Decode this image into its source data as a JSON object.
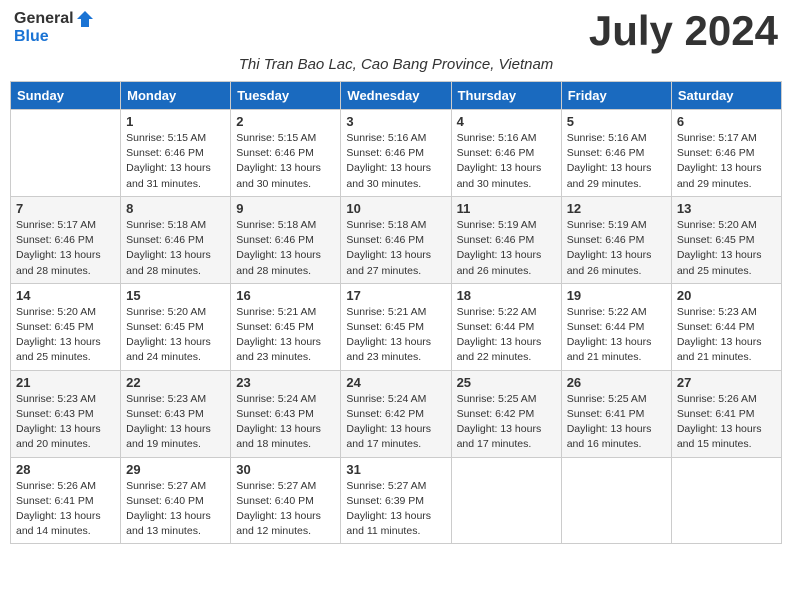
{
  "header": {
    "logo_general": "General",
    "logo_blue": "Blue",
    "title": "July 2024",
    "subtitle": "Thi Tran Bao Lac, Cao Bang Province, Vietnam"
  },
  "weekdays": [
    "Sunday",
    "Monday",
    "Tuesday",
    "Wednesday",
    "Thursday",
    "Friday",
    "Saturday"
  ],
  "weeks": [
    [
      {
        "day": "",
        "info": ""
      },
      {
        "day": "1",
        "info": "Sunrise: 5:15 AM\nSunset: 6:46 PM\nDaylight: 13 hours\nand 31 minutes."
      },
      {
        "day": "2",
        "info": "Sunrise: 5:15 AM\nSunset: 6:46 PM\nDaylight: 13 hours\nand 30 minutes."
      },
      {
        "day": "3",
        "info": "Sunrise: 5:16 AM\nSunset: 6:46 PM\nDaylight: 13 hours\nand 30 minutes."
      },
      {
        "day": "4",
        "info": "Sunrise: 5:16 AM\nSunset: 6:46 PM\nDaylight: 13 hours\nand 30 minutes."
      },
      {
        "day": "5",
        "info": "Sunrise: 5:16 AM\nSunset: 6:46 PM\nDaylight: 13 hours\nand 29 minutes."
      },
      {
        "day": "6",
        "info": "Sunrise: 5:17 AM\nSunset: 6:46 PM\nDaylight: 13 hours\nand 29 minutes."
      }
    ],
    [
      {
        "day": "7",
        "info": "Sunrise: 5:17 AM\nSunset: 6:46 PM\nDaylight: 13 hours\nand 28 minutes."
      },
      {
        "day": "8",
        "info": "Sunrise: 5:18 AM\nSunset: 6:46 PM\nDaylight: 13 hours\nand 28 minutes."
      },
      {
        "day": "9",
        "info": "Sunrise: 5:18 AM\nSunset: 6:46 PM\nDaylight: 13 hours\nand 28 minutes."
      },
      {
        "day": "10",
        "info": "Sunrise: 5:18 AM\nSunset: 6:46 PM\nDaylight: 13 hours\nand 27 minutes."
      },
      {
        "day": "11",
        "info": "Sunrise: 5:19 AM\nSunset: 6:46 PM\nDaylight: 13 hours\nand 26 minutes."
      },
      {
        "day": "12",
        "info": "Sunrise: 5:19 AM\nSunset: 6:46 PM\nDaylight: 13 hours\nand 26 minutes."
      },
      {
        "day": "13",
        "info": "Sunrise: 5:20 AM\nSunset: 6:45 PM\nDaylight: 13 hours\nand 25 minutes."
      }
    ],
    [
      {
        "day": "14",
        "info": "Sunrise: 5:20 AM\nSunset: 6:45 PM\nDaylight: 13 hours\nand 25 minutes."
      },
      {
        "day": "15",
        "info": "Sunrise: 5:20 AM\nSunset: 6:45 PM\nDaylight: 13 hours\nand 24 minutes."
      },
      {
        "day": "16",
        "info": "Sunrise: 5:21 AM\nSunset: 6:45 PM\nDaylight: 13 hours\nand 23 minutes."
      },
      {
        "day": "17",
        "info": "Sunrise: 5:21 AM\nSunset: 6:45 PM\nDaylight: 13 hours\nand 23 minutes."
      },
      {
        "day": "18",
        "info": "Sunrise: 5:22 AM\nSunset: 6:44 PM\nDaylight: 13 hours\nand 22 minutes."
      },
      {
        "day": "19",
        "info": "Sunrise: 5:22 AM\nSunset: 6:44 PM\nDaylight: 13 hours\nand 21 minutes."
      },
      {
        "day": "20",
        "info": "Sunrise: 5:23 AM\nSunset: 6:44 PM\nDaylight: 13 hours\nand 21 minutes."
      }
    ],
    [
      {
        "day": "21",
        "info": "Sunrise: 5:23 AM\nSunset: 6:43 PM\nDaylight: 13 hours\nand 20 minutes."
      },
      {
        "day": "22",
        "info": "Sunrise: 5:23 AM\nSunset: 6:43 PM\nDaylight: 13 hours\nand 19 minutes."
      },
      {
        "day": "23",
        "info": "Sunrise: 5:24 AM\nSunset: 6:43 PM\nDaylight: 13 hours\nand 18 minutes."
      },
      {
        "day": "24",
        "info": "Sunrise: 5:24 AM\nSunset: 6:42 PM\nDaylight: 13 hours\nand 17 minutes."
      },
      {
        "day": "25",
        "info": "Sunrise: 5:25 AM\nSunset: 6:42 PM\nDaylight: 13 hours\nand 17 minutes."
      },
      {
        "day": "26",
        "info": "Sunrise: 5:25 AM\nSunset: 6:41 PM\nDaylight: 13 hours\nand 16 minutes."
      },
      {
        "day": "27",
        "info": "Sunrise: 5:26 AM\nSunset: 6:41 PM\nDaylight: 13 hours\nand 15 minutes."
      }
    ],
    [
      {
        "day": "28",
        "info": "Sunrise: 5:26 AM\nSunset: 6:41 PM\nDaylight: 13 hours\nand 14 minutes."
      },
      {
        "day": "29",
        "info": "Sunrise: 5:27 AM\nSunset: 6:40 PM\nDaylight: 13 hours\nand 13 minutes."
      },
      {
        "day": "30",
        "info": "Sunrise: 5:27 AM\nSunset: 6:40 PM\nDaylight: 13 hours\nand 12 minutes."
      },
      {
        "day": "31",
        "info": "Sunrise: 5:27 AM\nSunset: 6:39 PM\nDaylight: 13 hours\nand 11 minutes."
      },
      {
        "day": "",
        "info": ""
      },
      {
        "day": "",
        "info": ""
      },
      {
        "day": "",
        "info": ""
      }
    ]
  ]
}
